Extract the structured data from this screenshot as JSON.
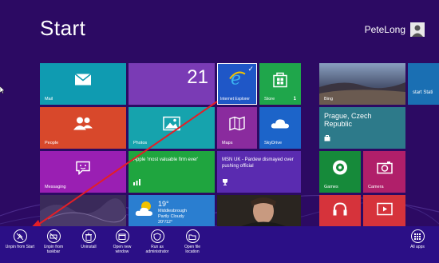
{
  "screen": {
    "title": "Start"
  },
  "user": {
    "name": "PeteLong"
  },
  "tiles": {
    "mail": {
      "label": "Mail",
      "color": "#0f9bb1"
    },
    "calendar": {
      "day": "21",
      "color": "#7a3bb5"
    },
    "ie": {
      "label": "Internet Explorer",
      "color": "#1f57c7"
    },
    "store": {
      "label": "Store",
      "badge": "1",
      "color": "#1fa64b"
    },
    "bing": {
      "label": "Bing"
    },
    "partial": {
      "label": "start Stati"
    },
    "people": {
      "label": "People",
      "color": "#d8482b"
    },
    "photos": {
      "label": "Photos",
      "color": "#16a3ad"
    },
    "maps": {
      "label": "Maps",
      "color": "#8a2b9e"
    },
    "skydrive": {
      "label": "SkyDrive",
      "color": "#1c64c9"
    },
    "prague": {
      "text": "Prague, Czech Republic"
    },
    "messaging": {
      "label": "Messaging",
      "color": "#9a1fb3"
    },
    "finance": {
      "text": "Apple 'most valuable firm ever'",
      "color": "#1fa53f"
    },
    "sport": {
      "text": "MSN UK - Pardew dismayed over pushing official",
      "color": "#5a2bb0"
    },
    "games": {
      "label": "Games",
      "color": "#168a3a"
    },
    "camera": {
      "label": "Camera",
      "color": "#b01f6a"
    },
    "weather": {
      "temp": "19°",
      "city": "Middlesbrough",
      "cond": "Partly Cloudy",
      "range": "20°/12°",
      "color": "#2a7ed0"
    },
    "music": {
      "color": "#d6333b"
    },
    "video": {
      "color": "#d6333b"
    }
  },
  "appbar": {
    "unpin_start": "Unpin from Start",
    "unpin_taskbar": "Unpin from taskbar",
    "uninstall": "Uninstall",
    "open_new_window": "Open new window",
    "run_admin": "Run as administrator",
    "open_file_location": "Open file location",
    "all_apps": "All apps"
  }
}
